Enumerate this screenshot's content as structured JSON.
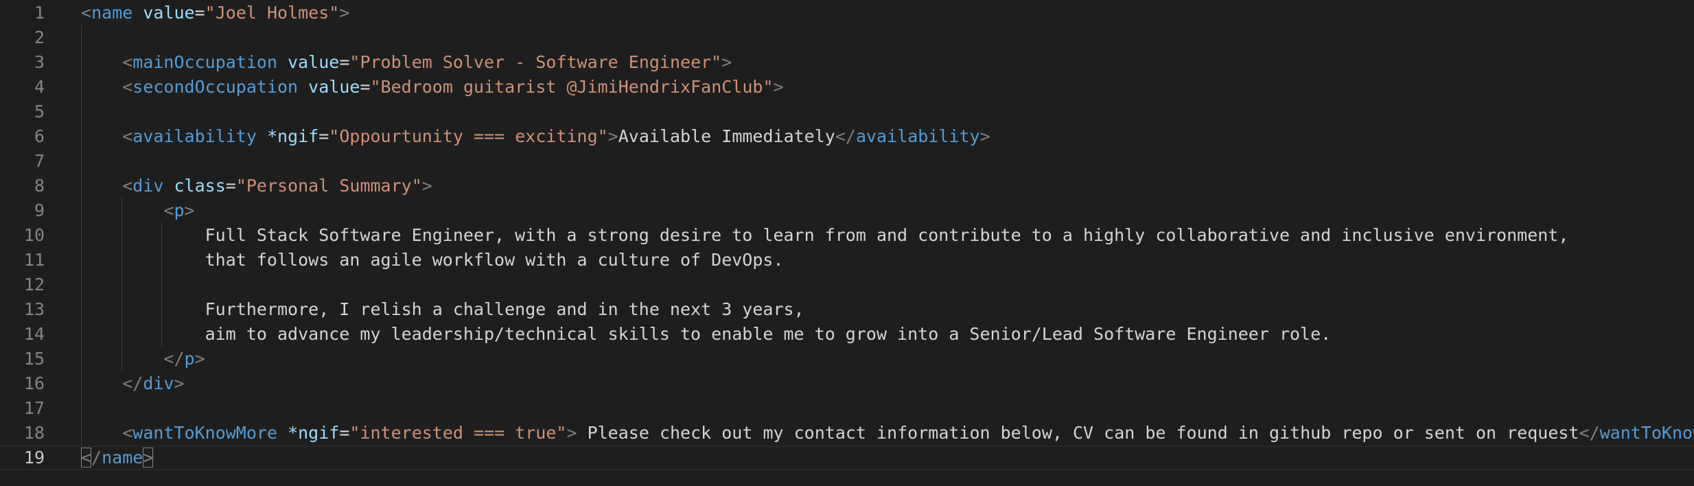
{
  "editor": {
    "colors": {
      "background": "#1e1e1e",
      "line_number": "#858585",
      "tag": "#569cd6",
      "attribute": "#9cdcfe",
      "string": "#ce9178",
      "text": "#d4d4d4",
      "bracket": "#808080"
    },
    "current_line": 19,
    "lines": [
      {
        "n": "1",
        "indent": "",
        "tokens": [
          {
            "t": "bracket",
            "v": "<"
          },
          {
            "t": "tag",
            "v": "name"
          },
          {
            "t": "text",
            "v": " "
          },
          {
            "t": "attr",
            "v": "value"
          },
          {
            "t": "eq",
            "v": "="
          },
          {
            "t": "str",
            "v": "\"Joel Holmes\""
          },
          {
            "t": "bracket",
            "v": ">"
          }
        ]
      },
      {
        "n": "2",
        "indent": "",
        "tokens": []
      },
      {
        "n": "3",
        "indent": "    ",
        "tokens": [
          {
            "t": "bracket",
            "v": "<"
          },
          {
            "t": "tag",
            "v": "mainOccupation"
          },
          {
            "t": "text",
            "v": " "
          },
          {
            "t": "attr",
            "v": "value"
          },
          {
            "t": "eq",
            "v": "="
          },
          {
            "t": "str",
            "v": "\"Problem Solver - Software Engineer\""
          },
          {
            "t": "bracket",
            "v": ">"
          }
        ]
      },
      {
        "n": "4",
        "indent": "    ",
        "tokens": [
          {
            "t": "bracket",
            "v": "<"
          },
          {
            "t": "tag",
            "v": "secondOccupation"
          },
          {
            "t": "text",
            "v": " "
          },
          {
            "t": "attr",
            "v": "value"
          },
          {
            "t": "eq",
            "v": "="
          },
          {
            "t": "str",
            "v": "\"Bedroom guitarist @JimiHendrixFanClub\""
          },
          {
            "t": "bracket",
            "v": ">"
          }
        ]
      },
      {
        "n": "5",
        "indent": "",
        "tokens": []
      },
      {
        "n": "6",
        "indent": "    ",
        "tokens": [
          {
            "t": "bracket",
            "v": "<"
          },
          {
            "t": "tag",
            "v": "availability"
          },
          {
            "t": "text",
            "v": " "
          },
          {
            "t": "attr",
            "v": "*ngif"
          },
          {
            "t": "eq",
            "v": "="
          },
          {
            "t": "str",
            "v": "\"Oppourtunity === exciting\""
          },
          {
            "t": "bracket",
            "v": ">"
          },
          {
            "t": "text",
            "v": "Available Immediately"
          },
          {
            "t": "bracket",
            "v": "</"
          },
          {
            "t": "tag",
            "v": "availability"
          },
          {
            "t": "bracket",
            "v": ">"
          }
        ]
      },
      {
        "n": "7",
        "indent": "",
        "tokens": []
      },
      {
        "n": "8",
        "indent": "    ",
        "tokens": [
          {
            "t": "bracket",
            "v": "<"
          },
          {
            "t": "tag",
            "v": "div"
          },
          {
            "t": "text",
            "v": " "
          },
          {
            "t": "attr",
            "v": "class"
          },
          {
            "t": "eq",
            "v": "="
          },
          {
            "t": "str",
            "v": "\"Personal Summary\""
          },
          {
            "t": "bracket",
            "v": ">"
          }
        ]
      },
      {
        "n": "9",
        "indent": "        ",
        "tokens": [
          {
            "t": "bracket",
            "v": "<"
          },
          {
            "t": "tag",
            "v": "p"
          },
          {
            "t": "bracket",
            "v": ">"
          }
        ]
      },
      {
        "n": "10",
        "indent": "            ",
        "tokens": [
          {
            "t": "text",
            "v": "Full Stack Software Engineer, with a strong desire to learn from and contribute to a highly collaborative and inclusive environment,"
          }
        ]
      },
      {
        "n": "11",
        "indent": "            ",
        "tokens": [
          {
            "t": "text",
            "v": "that follows an agile workflow with a culture of DevOps."
          }
        ]
      },
      {
        "n": "12",
        "indent": "",
        "tokens": []
      },
      {
        "n": "13",
        "indent": "            ",
        "tokens": [
          {
            "t": "text",
            "v": "Furthermore, I relish a challenge and in the next 3 years,"
          }
        ]
      },
      {
        "n": "14",
        "indent": "            ",
        "tokens": [
          {
            "t": "text",
            "v": "aim to advance my leadership/technical skills to enable me to grow into a Senior/Lead Software Engineer role."
          }
        ]
      },
      {
        "n": "15",
        "indent": "        ",
        "tokens": [
          {
            "t": "bracket",
            "v": "</"
          },
          {
            "t": "tag",
            "v": "p"
          },
          {
            "t": "bracket",
            "v": ">"
          }
        ]
      },
      {
        "n": "16",
        "indent": "    ",
        "tokens": [
          {
            "t": "bracket",
            "v": "</"
          },
          {
            "t": "tag",
            "v": "div"
          },
          {
            "t": "bracket",
            "v": ">"
          }
        ]
      },
      {
        "n": "17",
        "indent": "",
        "tokens": []
      },
      {
        "n": "18",
        "indent": "    ",
        "tokens": [
          {
            "t": "bracket",
            "v": "<"
          },
          {
            "t": "tag",
            "v": "wantToKnowMore"
          },
          {
            "t": "text",
            "v": " "
          },
          {
            "t": "attr",
            "v": "*ngif"
          },
          {
            "t": "eq",
            "v": "="
          },
          {
            "t": "str",
            "v": "\"interested === true\""
          },
          {
            "t": "bracket",
            "v": ">"
          },
          {
            "t": "text",
            "v": " Please check out my contact information below, CV can be found in github repo or sent on request"
          },
          {
            "t": "bracket",
            "v": "</"
          },
          {
            "t": "tag",
            "v": "wantToKnowMore"
          },
          {
            "t": "bracket",
            "v": ">"
          }
        ]
      },
      {
        "n": "19",
        "indent": "",
        "tokens": [
          {
            "t": "bracket-match",
            "v": "<"
          },
          {
            "t": "bracket",
            "v": "/"
          },
          {
            "t": "tag",
            "v": "name"
          },
          {
            "t": "bracket-match",
            "v": ">"
          }
        ]
      }
    ]
  }
}
